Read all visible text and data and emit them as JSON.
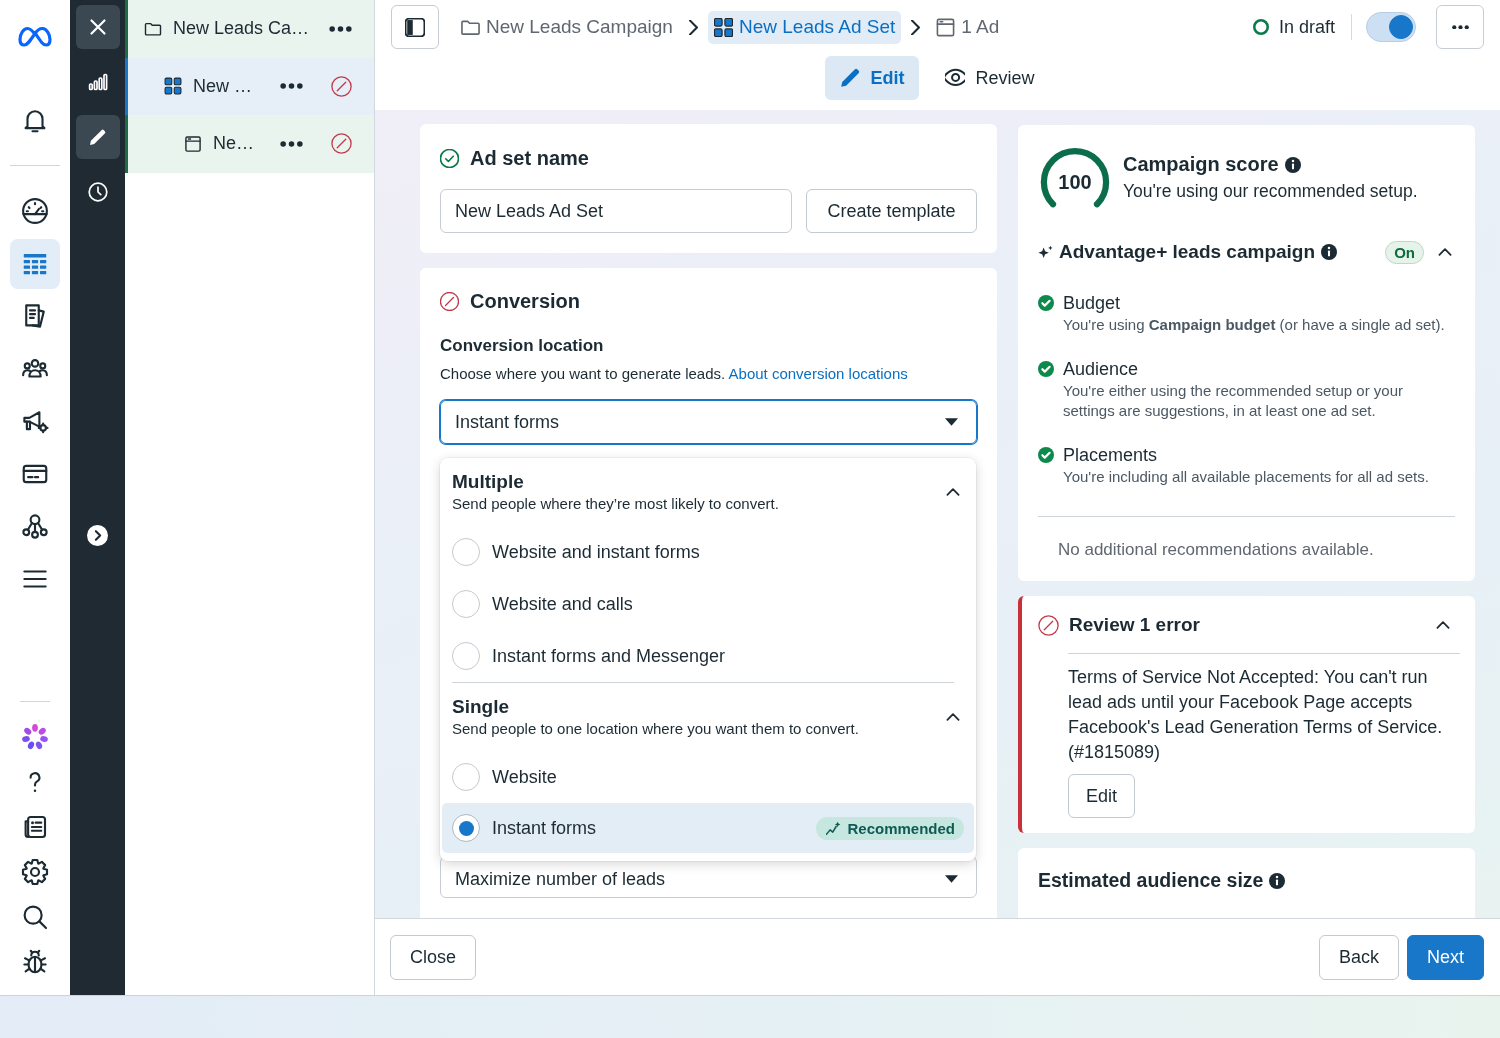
{
  "left_nav": {
    "items": [
      {
        "selected": false
      },
      {
        "selected": true
      },
      {
        "selected": false
      },
      {
        "selected": false
      },
      {
        "selected": false
      },
      {
        "selected": false
      },
      {
        "selected": false
      },
      {
        "selected": false
      }
    ]
  },
  "rail": {
    "items": [
      {
        "selected": false
      },
      {
        "selected": true
      },
      {
        "selected": false
      }
    ]
  },
  "tree": [
    {
      "kind": "campaign",
      "label": "New Leads Ca…",
      "selected": false,
      "error": false,
      "children": [
        {
          "kind": "ad_set",
          "label": "New …",
          "selected": true,
          "error": true,
          "children": [
            {
              "kind": "ad",
              "label": "Ne…",
              "selected": false,
              "error": true
            }
          ]
        }
      ]
    }
  ],
  "header": {
    "breadcrumb": [
      {
        "kind": "campaign",
        "label": "New Leads Campaign",
        "selected": false
      },
      {
        "kind": "ad_set",
        "label": "New Leads Ad Set",
        "selected": true
      },
      {
        "kind": "ad",
        "label": "1 Ad",
        "selected": false
      }
    ],
    "status": {
      "label": "In draft"
    },
    "toggle": {
      "on": true
    },
    "mode_tabs": [
      {
        "label": "Edit",
        "selected": true
      },
      {
        "label": "Review",
        "selected": false
      }
    ]
  },
  "ad_set_name": {
    "title": "Ad set name",
    "valid": true,
    "name_field": {
      "value": "New Leads Ad Set"
    },
    "button": "Create template"
  },
  "conversion": {
    "title": "Conversion",
    "valid": false,
    "section_title": "Conversion location",
    "description": "Choose where you want to generate leads.",
    "link": "About conversion locations",
    "select": {
      "value": "Instant forms",
      "open": true
    },
    "menu": {
      "groups": [
        {
          "title": "Multiple",
          "description": "Send people where they’re most likely to convert.",
          "expanded": true,
          "options": [
            {
              "label": "Website and instant forms",
              "selected": false
            },
            {
              "label": "Website and calls",
              "selected": false
            },
            {
              "label": "Instant forms and Messenger",
              "selected": false
            }
          ]
        },
        {
          "title": "Single",
          "description": "Send people to one location where you want them to convert.",
          "expanded": true,
          "options": [
            {
              "label": "Website",
              "selected": false
            },
            {
              "label": "Instant forms",
              "selected": true,
              "badge": "Recommended"
            }
          ]
        }
      ]
    },
    "select_2": {
      "value": "Maximize number of leads"
    }
  },
  "campaign_score": {
    "score": "100",
    "level": 1,
    "title": "Campaign score",
    "subtitle": "You're using our recommended setup.",
    "advantage": {
      "title": "Advantage+ leads campaign",
      "badge": "On",
      "expanded": true,
      "items": [
        {
          "title": "Budget",
          "text": "You're using **Campaign budget** (or have a single ad set).",
          "done": true
        },
        {
          "title": "Audience",
          "text": "You're either using the recommended setup or your settings are suggestions, in at least one ad set.",
          "done": true
        },
        {
          "title": "Placements",
          "text": "You're including all available placements for all ad sets.",
          "done": true
        }
      ]
    },
    "note": "No additional recommendations available."
  },
  "error_card": {
    "title": "Review 1 error",
    "expanded": true,
    "message": "Terms of Service Not Accepted: You can't run lead ads until your Facebook Page accepts Facebook's Lead Generation Terms of Service. (#1815089)",
    "button": "Edit"
  },
  "audience_card": {
    "title": "Estimated audience size"
  },
  "footer": {
    "buttons": [
      {
        "label": "Close",
        "kind": "secondary"
      },
      {
        "label": "Back",
        "kind": "secondary"
      },
      {
        "label": "Next",
        "kind": "primary"
      }
    ]
  }
}
